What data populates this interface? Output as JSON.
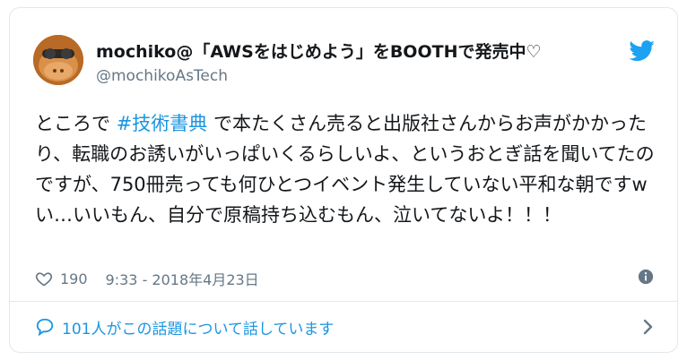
{
  "tweet": {
    "author_name": "mochiko@「AWSをはじめよう」をBOOTHで発売中♡",
    "author_handle": "@mochikoAsTech",
    "text_before": "ところで ",
    "hashtag": "#技術書典",
    "text_after": " で本たくさん売ると出版社さんからお声がかかったり、転職のお誘いがいっぱいくるらしいよ、というおとぎ話を聞いてたのですが、750冊売っても何ひとつイベント発生していない平和な朝ですw",
    "text_line2": "い…いいもん、自分で原稿持ち込むもん、泣いてないよ！！！",
    "likes": "190",
    "timestamp": "9:33 - 2018年4月23日",
    "conversation": "101人がこの話題について話しています"
  },
  "icons": {
    "avatar": "avatar-image",
    "bird": "twitter-bird-icon",
    "heart": "heart-icon",
    "info": "info-icon",
    "bubble": "speech-bubble-icon",
    "chevron": "chevron-right-icon"
  },
  "colors": {
    "link": "#1b95e0",
    "text": "#14171a",
    "muted": "#657786",
    "border": "#e1e8ed"
  }
}
